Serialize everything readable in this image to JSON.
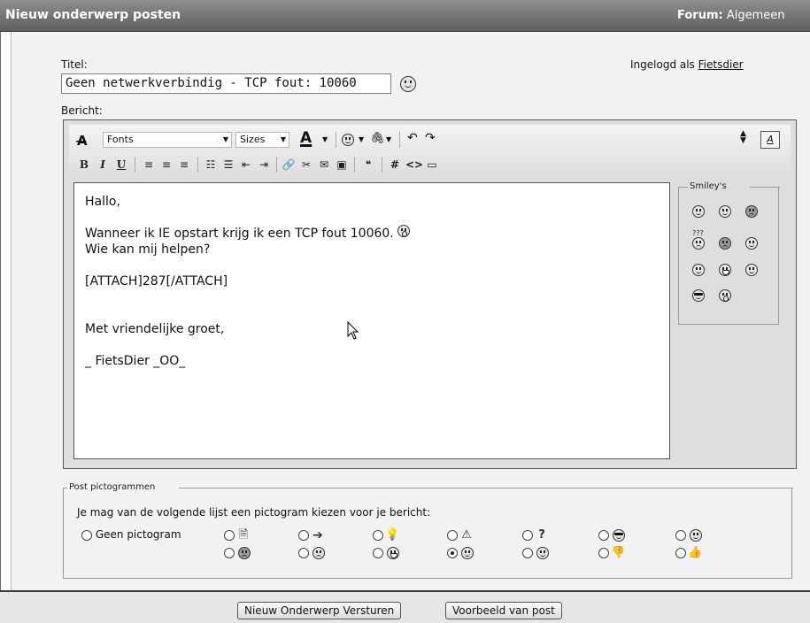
{
  "header": {
    "title": "Nieuw onderwerp posten",
    "forum_label": "Forum:",
    "forum_value": "Algemeen"
  },
  "form": {
    "title_label": "Titel:",
    "title_value": "Geen netwerkverbindig - TCP fout: 10060",
    "logged_in_prefix": "Ingelogd als",
    "username": "Fietsdier",
    "message_label": "Bericht:"
  },
  "toolbar": {
    "font_select": "Fonts",
    "size_select": "Sizes",
    "text_color_icon": "A"
  },
  "message": {
    "lines": [
      "Hallo,",
      "",
      "Wanneer ik IE opstart krijg ik een TCP fout 10060.",
      "Wie kan mij helpen?",
      "",
      "[ATTACH]287[/ATTACH]",
      "",
      "",
      "Met vriendelijke groet,",
      "",
      "_ FietsDier _OO_"
    ]
  },
  "smilies": {
    "legend": "Smiley's",
    "icons": [
      "smile",
      "smile",
      "mad",
      "confused",
      "frown",
      "wink",
      "smile",
      "biggrin",
      "rolleyes",
      "cool",
      "eek"
    ]
  },
  "post_icons": {
    "legend": "Post pictogrammen",
    "instruction": "Je mag van de volgende lijst een pictogram kiezen voor je bericht:",
    "no_icon_label": "Geen pictogram",
    "row1": [
      "doc-icon",
      "arrow-icon",
      "lightbulb-icon",
      "exclamation-icon",
      "question-icon",
      "cool-icon",
      "smile-icon"
    ],
    "row2": [
      "mad-icon",
      "frown-icon",
      "biggrin-icon",
      "redface-icon",
      "wink-icon",
      "thumbs-down-icon",
      "thumbs-up-icon"
    ],
    "selected": "redface-icon"
  },
  "buttons": {
    "submit": "Nieuw Onderwerp Versturen",
    "preview": "Voorbeeld van post"
  }
}
